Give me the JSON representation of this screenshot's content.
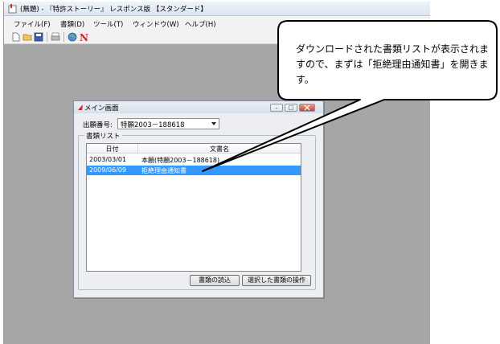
{
  "app": {
    "title": "(無題)  -  『特許ストーリー』 レスポンス版 【スタンダード】",
    "menu": [
      "ファイル(F)",
      "書類(D)",
      "ツール(T)",
      "ウィンドウ(W)",
      "ヘルプ(H)"
    ],
    "toolbar": [
      "new-file-icon",
      "open-folder-icon",
      "save-disk-icon",
      "print-icon",
      "globe-icon",
      "n-logo-icon"
    ]
  },
  "child": {
    "title": "メイン画面",
    "minimize": "–",
    "maximize": "□",
    "application_label": "出願番号:",
    "application_value": "特願2003－188618",
    "list_label": "書類リスト",
    "columns": [
      "日付",
      "文書名"
    ],
    "rows": [
      {
        "date": "2003/03/01",
        "name": "本願(特願2003－188618)",
        "selected": false
      },
      {
        "date": "2009/06/09",
        "name": "拒絶理由通知書",
        "selected": true
      }
    ],
    "buttons": {
      "read": "書類の読込",
      "operate": "選択した書類の操作"
    }
  },
  "callout": {
    "text": "ダウンロードされた書類リストが表示されますので、まずは「拒絶理由通知書」を開きます。"
  },
  "colors": {
    "selection": "#3399ff",
    "workspace": "#a6a6a6"
  }
}
